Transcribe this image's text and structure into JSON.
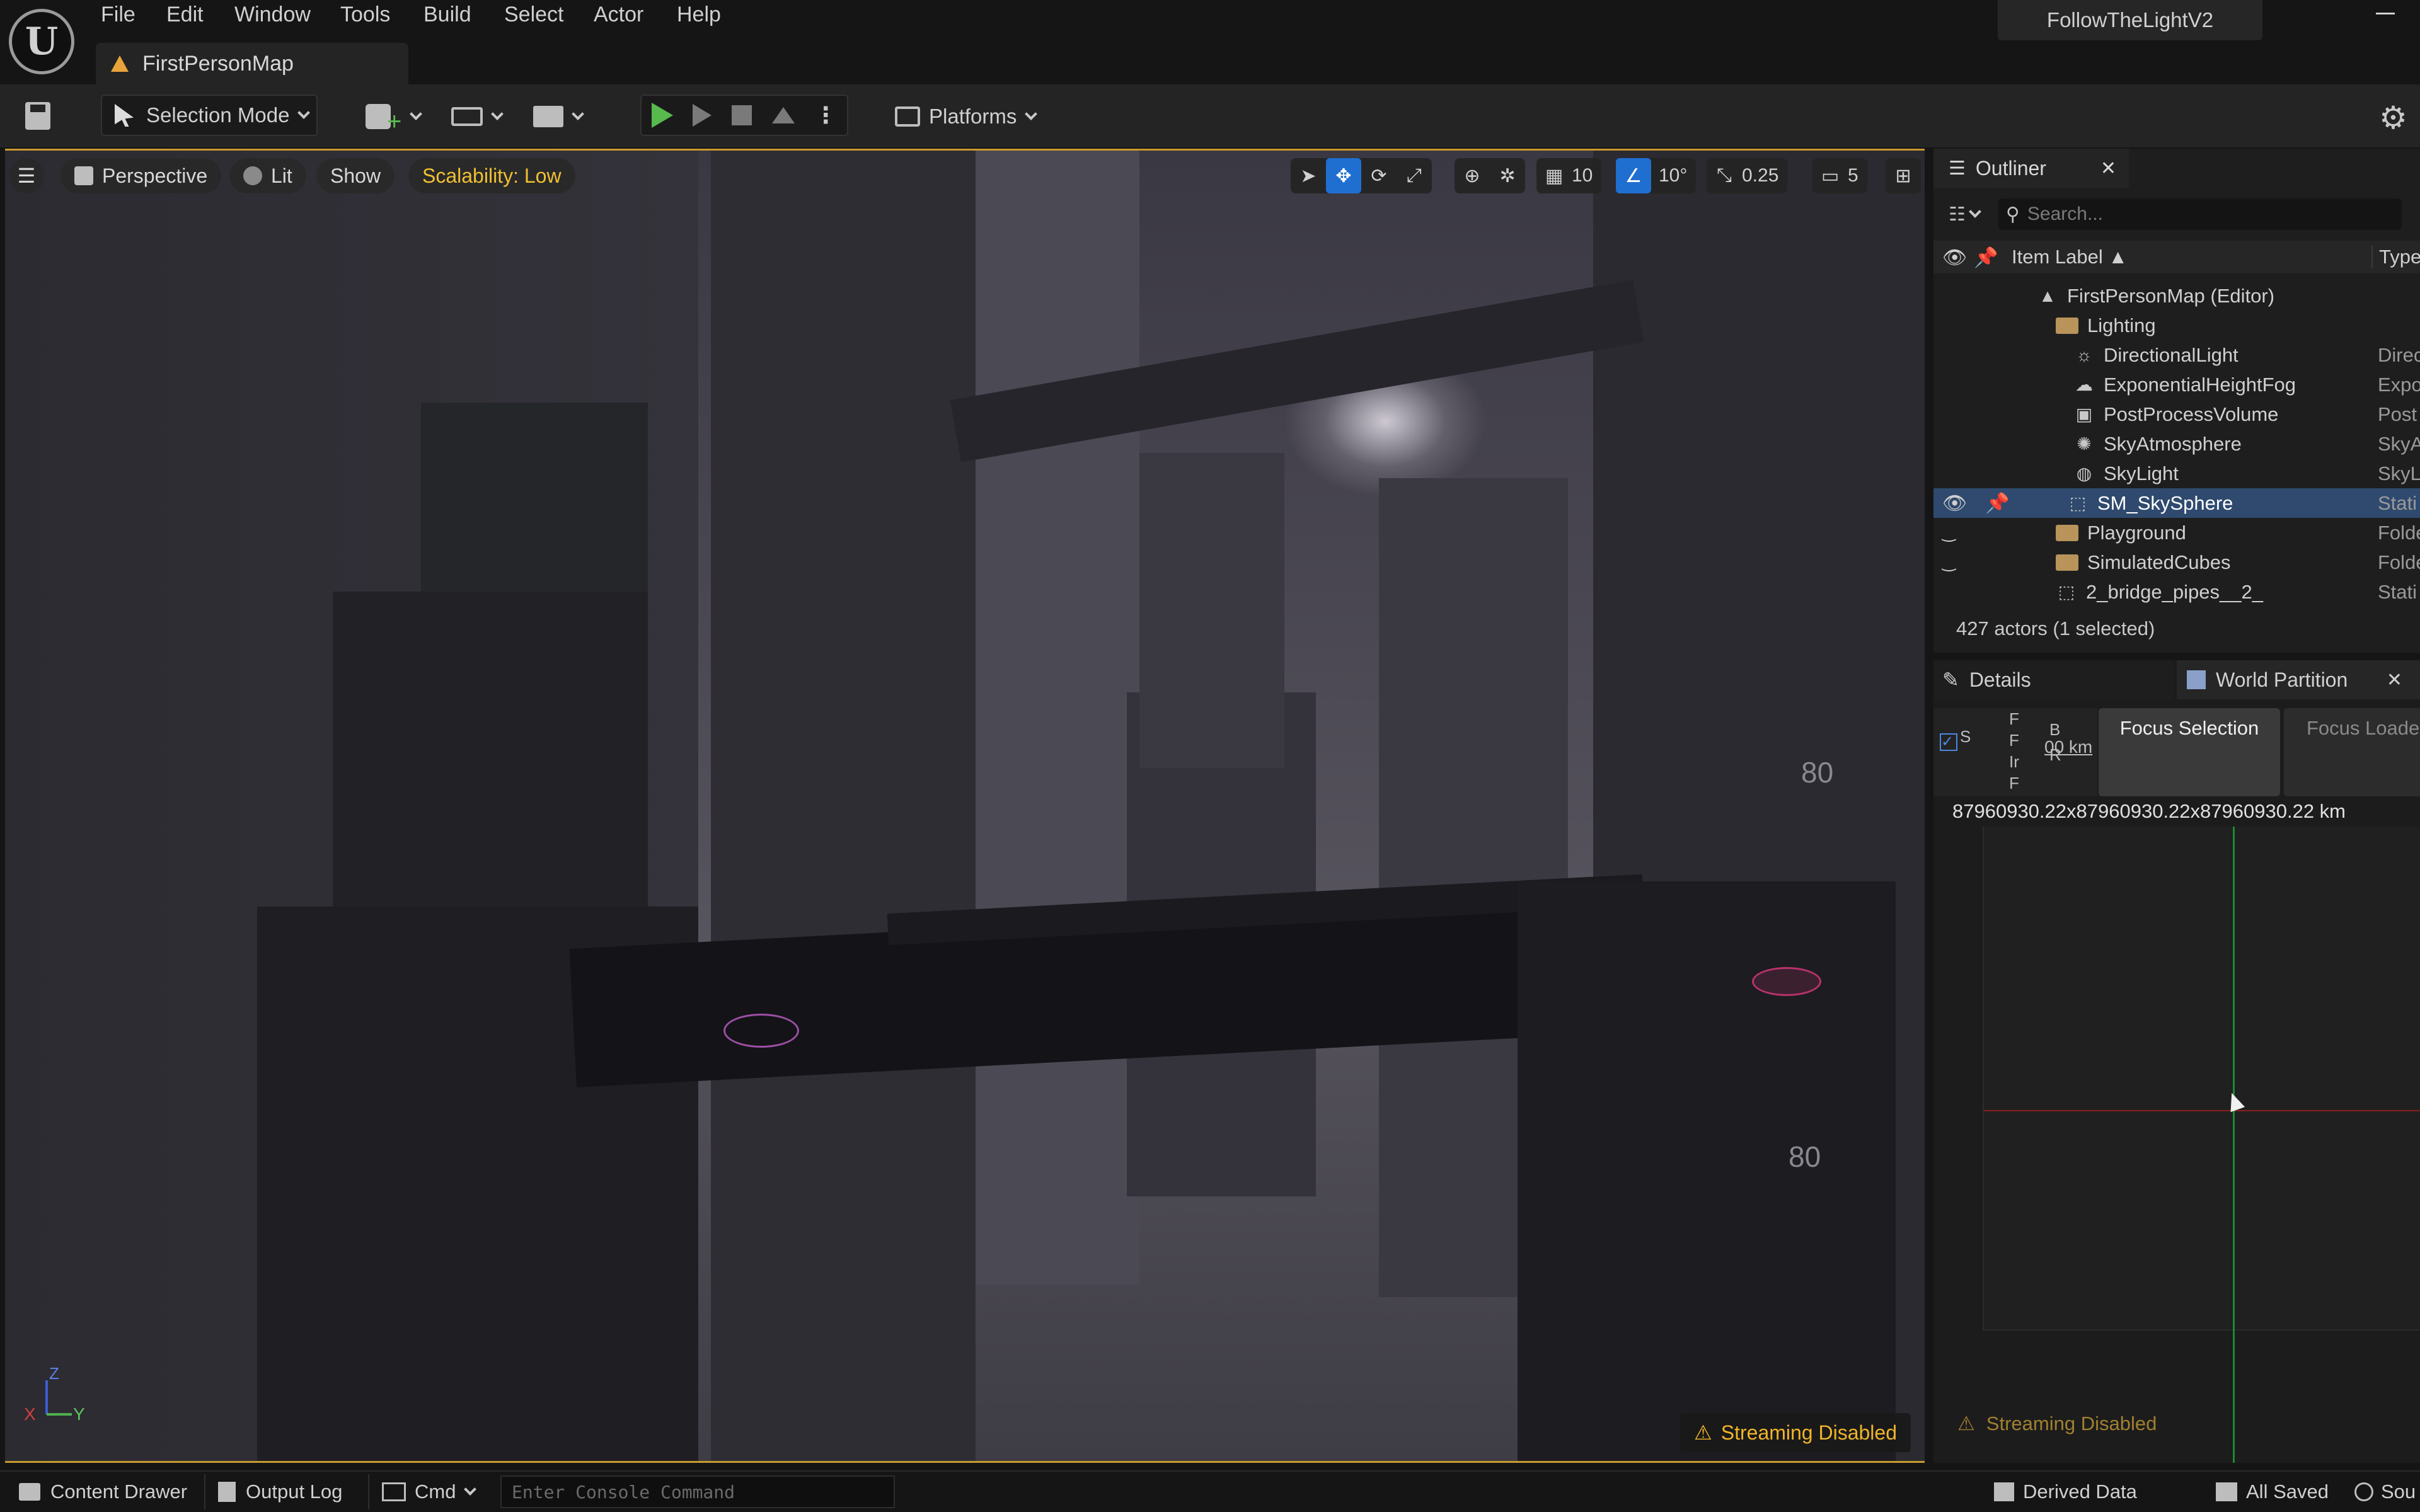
{
  "menu": [
    "File",
    "Edit",
    "Window",
    "Tools",
    "Build",
    "Select",
    "Actor",
    "Help"
  ],
  "project_title": "FollowTheLightV2",
  "map_tab": "FirstPersonMap",
  "toolbar": {
    "mode": "Selection Mode",
    "platforms": "Platforms"
  },
  "viewport": {
    "perspective": "Perspective",
    "lit": "Lit",
    "show": "Show",
    "scalability": "Scalability: Low",
    "grid_snap": "10",
    "rotation_snap": "10°",
    "scale_snap": "0.25",
    "camera_speed": "5",
    "streaming": "Streaming Disabled",
    "axis_x": "X",
    "axis_y": "Y",
    "axis_z": "Z",
    "sign_upper": "80",
    "sign_lower": "80"
  },
  "outliner": {
    "tab": "Outliner",
    "search_placeholder": "Search...",
    "col_label": "Item Label ▲",
    "col_type": "Type",
    "rows": [
      {
        "label": "FirstPersonMap (Editor)",
        "type": ""
      },
      {
        "label": "Lighting",
        "type": ""
      },
      {
        "label": "DirectionalLight",
        "type": "Direc"
      },
      {
        "label": "ExponentialHeightFog",
        "type": "Expo"
      },
      {
        "label": "PostProcessVolume",
        "type": "Post"
      },
      {
        "label": "SkyAtmosphere",
        "type": "SkyA"
      },
      {
        "label": "SkyLight",
        "type": "SkyL"
      },
      {
        "label": "SM_SkySphere",
        "type": "Stati"
      },
      {
        "label": "Playground",
        "type": "Folde"
      },
      {
        "label": "SimulatedCubes",
        "type": "Folde"
      },
      {
        "label": "2_bridge_pipes__2_",
        "type": "Stati"
      }
    ],
    "status": "427 actors (1 selected)"
  },
  "details": {
    "tab_details": "Details",
    "tab_world_partition": "World Partition",
    "focus_selection": "Focus Selection",
    "focus_loaded": "Focus Loade",
    "size_readout": "87960930.22x87960930.22x87960930.22 km",
    "clipped_letters_1": "S",
    "clipped_letters_2": "F\nF\nIr\nF",
    "clipped_letters_3": "B\nR",
    "clipped_km": "00 km",
    "streaming": "Streaming Disabled"
  },
  "bottom": {
    "content_drawer": "Content Drawer",
    "output_log": "Output Log",
    "cmd": "Cmd",
    "console_placeholder": "Enter Console Command",
    "derived_data": "Derived Data",
    "all_saved": "All Saved",
    "source": "Sou"
  },
  "colors": {
    "accent_blue": "#1f6fd1",
    "play_green": "#58b94c",
    "warning_yellow": "#f0b429",
    "selection_row": "#2f4a6e"
  }
}
